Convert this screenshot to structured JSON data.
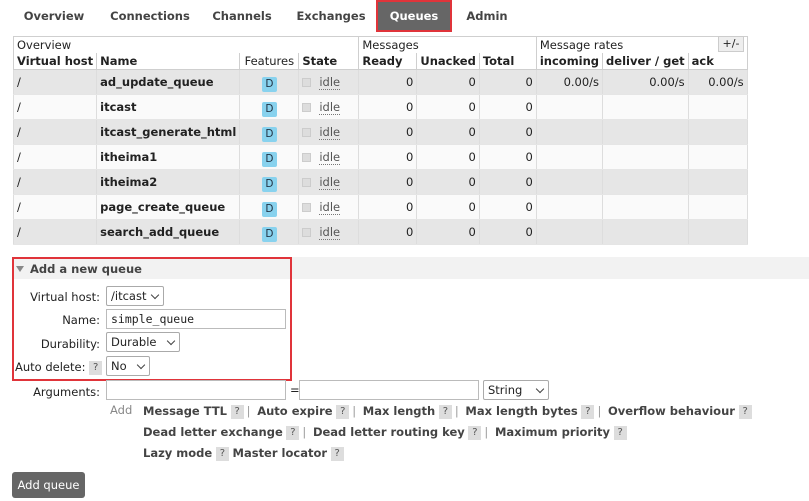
{
  "nav": {
    "tabs": [
      {
        "label": "Overview"
      },
      {
        "label": "Connections"
      },
      {
        "label": "Channels"
      },
      {
        "label": "Exchanges"
      },
      {
        "label": "Queues",
        "active": true
      },
      {
        "label": "Admin"
      }
    ]
  },
  "table": {
    "groups": {
      "overview": "Overview",
      "messages": "Messages",
      "rates": "Message rates"
    },
    "columns": {
      "vhost": "Virtual host",
      "name": "Name",
      "features": "Features",
      "state": "State",
      "ready": "Ready",
      "unacked": "Unacked",
      "total": "Total",
      "incoming": "incoming",
      "deliver": "deliver / get",
      "ack": "ack"
    },
    "plus_minus": "+/-",
    "rows": [
      {
        "vhost": "/",
        "name": "ad_update_queue",
        "feature": "D",
        "state": "idle",
        "ready": "0",
        "unacked": "0",
        "total": "0",
        "incoming": "0.00/s",
        "deliver": "0.00/s",
        "ack": "0.00/s"
      },
      {
        "vhost": "/",
        "name": "itcast",
        "feature": "D",
        "state": "idle",
        "ready": "0",
        "unacked": "0",
        "total": "0",
        "incoming": "",
        "deliver": "",
        "ack": ""
      },
      {
        "vhost": "/",
        "name": "itcast_generate_html",
        "feature": "D",
        "state": "idle",
        "ready": "0",
        "unacked": "0",
        "total": "0",
        "incoming": "",
        "deliver": "",
        "ack": ""
      },
      {
        "vhost": "/",
        "name": "itheima1",
        "feature": "D",
        "state": "idle",
        "ready": "0",
        "unacked": "0",
        "total": "0",
        "incoming": "",
        "deliver": "",
        "ack": ""
      },
      {
        "vhost": "/",
        "name": "itheima2",
        "feature": "D",
        "state": "idle",
        "ready": "0",
        "unacked": "0",
        "total": "0",
        "incoming": "",
        "deliver": "",
        "ack": ""
      },
      {
        "vhost": "/",
        "name": "page_create_queue",
        "feature": "D",
        "state": "idle",
        "ready": "0",
        "unacked": "0",
        "total": "0",
        "incoming": "",
        "deliver": "",
        "ack": ""
      },
      {
        "vhost": "/",
        "name": "search_add_queue",
        "feature": "D",
        "state": "idle",
        "ready": "0",
        "unacked": "0",
        "total": "0",
        "incoming": "",
        "deliver": "",
        "ack": ""
      }
    ]
  },
  "add_queue": {
    "title": "Add a new queue",
    "vhost_label": "Virtual host:",
    "vhost_value": "/itcast",
    "name_label": "Name:",
    "name_value": "simple_queue",
    "durability_label": "Durability:",
    "durability_value": "Durable",
    "autodelete_label": "Auto delete:",
    "autodelete_help": "?",
    "autodelete_value": "No",
    "arguments_label": "Arguments:",
    "arguments_eq": "=",
    "arguments_type": "String",
    "add_label": "Add",
    "arg_options": [
      "Message TTL",
      "Auto expire",
      "Max length",
      "Max length bytes",
      "Overflow behaviour",
      "Dead letter exchange",
      "Dead letter routing key",
      "Maximum priority",
      "Lazy mode",
      "Master locator"
    ],
    "help": "?",
    "separator": "|",
    "submit_label": "Add queue"
  },
  "colors": {
    "accent_border": "#e0343a",
    "active_tab_bg": "#666666",
    "feature_badge": "#88d2ee"
  }
}
